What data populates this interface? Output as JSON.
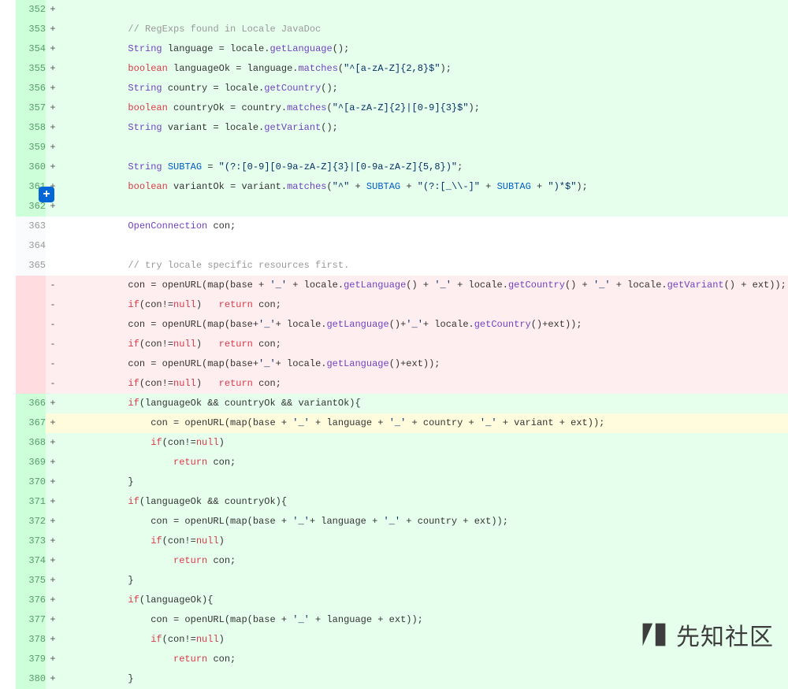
{
  "watermark": {
    "text": "先知社区"
  },
  "addCommentIcon": "+",
  "lines": [
    {
      "newNum": "352",
      "marker": "+",
      "type": "added",
      "tokens": []
    },
    {
      "newNum": "353",
      "marker": "+",
      "type": "added",
      "tokens": [
        {
          "t": "            ",
          "c": ""
        },
        {
          "t": "// RegExps found in Locale JavaDoc",
          "c": "k-cmt"
        }
      ]
    },
    {
      "newNum": "354",
      "marker": "+",
      "type": "added",
      "tokens": [
        {
          "t": "            ",
          "c": ""
        },
        {
          "t": "String",
          "c": "k-type"
        },
        {
          "t": " language = locale.",
          "c": ""
        },
        {
          "t": "getLanguage",
          "c": "k-type"
        },
        {
          "t": "();",
          "c": ""
        }
      ]
    },
    {
      "newNum": "355",
      "marker": "+",
      "type": "added",
      "tokens": [
        {
          "t": "            ",
          "c": ""
        },
        {
          "t": "boolean",
          "c": "k-kw"
        },
        {
          "t": " languageOk = language.",
          "c": ""
        },
        {
          "t": "matches",
          "c": "k-type"
        },
        {
          "t": "(",
          "c": ""
        },
        {
          "t": "\"^[a-zA-Z]{2,8}$\"",
          "c": "k-str"
        },
        {
          "t": ");",
          "c": ""
        }
      ]
    },
    {
      "newNum": "356",
      "marker": "+",
      "type": "added",
      "tokens": [
        {
          "t": "            ",
          "c": ""
        },
        {
          "t": "String",
          "c": "k-type"
        },
        {
          "t": " country = locale.",
          "c": ""
        },
        {
          "t": "getCountry",
          "c": "k-type"
        },
        {
          "t": "();",
          "c": ""
        }
      ]
    },
    {
      "newNum": "357",
      "marker": "+",
      "type": "added",
      "tokens": [
        {
          "t": "            ",
          "c": ""
        },
        {
          "t": "boolean",
          "c": "k-kw"
        },
        {
          "t": " countryOk = country.",
          "c": ""
        },
        {
          "t": "matches",
          "c": "k-type"
        },
        {
          "t": "(",
          "c": ""
        },
        {
          "t": "\"^[a-zA-Z]{2}|[0-9]{3}$\"",
          "c": "k-str"
        },
        {
          "t": ");",
          "c": ""
        }
      ]
    },
    {
      "newNum": "358",
      "marker": "+",
      "type": "added",
      "tokens": [
        {
          "t": "            ",
          "c": ""
        },
        {
          "t": "String",
          "c": "k-type"
        },
        {
          "t": " variant = locale.",
          "c": ""
        },
        {
          "t": "getVariant",
          "c": "k-type"
        },
        {
          "t": "();",
          "c": ""
        }
      ]
    },
    {
      "newNum": "359",
      "marker": "+",
      "type": "added",
      "tokens": []
    },
    {
      "newNum": "360",
      "marker": "+",
      "type": "added",
      "tokens": [
        {
          "t": "            ",
          "c": ""
        },
        {
          "t": "String",
          "c": "k-type"
        },
        {
          "t": " ",
          "c": ""
        },
        {
          "t": "SUBTAG",
          "c": "k-const"
        },
        {
          "t": " = ",
          "c": ""
        },
        {
          "t": "\"(?:[0-9][0-9a-zA-Z]{3}|[0-9a-zA-Z]{5,8})\"",
          "c": "k-str"
        },
        {
          "t": ";",
          "c": ""
        }
      ]
    },
    {
      "newNum": "361",
      "marker": "+",
      "type": "added",
      "tokens": [
        {
          "t": "            ",
          "c": ""
        },
        {
          "t": "boolean",
          "c": "k-kw"
        },
        {
          "t": " variantOk = variant.",
          "c": ""
        },
        {
          "t": "matches",
          "c": "k-type"
        },
        {
          "t": "(",
          "c": ""
        },
        {
          "t": "\"^\"",
          "c": "k-str"
        },
        {
          "t": " + ",
          "c": ""
        },
        {
          "t": "SUBTAG",
          "c": "k-const"
        },
        {
          "t": " + ",
          "c": ""
        },
        {
          "t": "\"(?:[_\\\\-]\"",
          "c": "k-str"
        },
        {
          "t": " + ",
          "c": ""
        },
        {
          "t": "SUBTAG",
          "c": "k-const"
        },
        {
          "t": " + ",
          "c": ""
        },
        {
          "t": "\")*$\"",
          "c": "k-str"
        },
        {
          "t": ");",
          "c": ""
        }
      ]
    },
    {
      "newNum": "362",
      "marker": "+",
      "type": "added",
      "tokens": []
    },
    {
      "newNum": "363",
      "marker": "",
      "type": "context",
      "tokens": [
        {
          "t": "            ",
          "c": ""
        },
        {
          "t": "OpenConnection",
          "c": "k-type"
        },
        {
          "t": " con;",
          "c": ""
        }
      ]
    },
    {
      "newNum": "364",
      "marker": "",
      "type": "context",
      "tokens": []
    },
    {
      "newNum": "365",
      "marker": "",
      "type": "context",
      "tokens": [
        {
          "t": "            ",
          "c": ""
        },
        {
          "t": "// try locale specific resources first.",
          "c": "k-cmt"
        }
      ]
    },
    {
      "newNum": "",
      "marker": "-",
      "type": "removed",
      "tokens": [
        {
          "t": "            con = openURL(map(base + ",
          "c": ""
        },
        {
          "t": "'_'",
          "c": "k-str"
        },
        {
          "t": " + locale.",
          "c": ""
        },
        {
          "t": "getLanguage",
          "c": "k-type"
        },
        {
          "t": "() + ",
          "c": ""
        },
        {
          "t": "'_'",
          "c": "k-str"
        },
        {
          "t": " + locale.",
          "c": ""
        },
        {
          "t": "getCountry",
          "c": "k-type"
        },
        {
          "t": "() + ",
          "c": ""
        },
        {
          "t": "'_'",
          "c": "k-str"
        },
        {
          "t": " + locale.",
          "c": ""
        },
        {
          "t": "getVariant",
          "c": "k-type"
        },
        {
          "t": "() + ext));",
          "c": ""
        }
      ]
    },
    {
      "newNum": "",
      "marker": "-",
      "type": "removed",
      "tokens": [
        {
          "t": "            ",
          "c": ""
        },
        {
          "t": "if",
          "c": "k-kw"
        },
        {
          "t": "(con!=",
          "c": ""
        },
        {
          "t": "null",
          "c": "k-kw"
        },
        {
          "t": ")   ",
          "c": ""
        },
        {
          "t": "return",
          "c": "k-kw"
        },
        {
          "t": " con;",
          "c": ""
        }
      ]
    },
    {
      "newNum": "",
      "marker": "-",
      "type": "removed",
      "tokens": [
        {
          "t": "            con = openURL(map(base+",
          "c": ""
        },
        {
          "t": "'_'",
          "c": "k-str"
        },
        {
          "t": "+ locale.",
          "c": ""
        },
        {
          "t": "getLanguage",
          "c": "k-type"
        },
        {
          "t": "()+",
          "c": ""
        },
        {
          "t": "'_'",
          "c": "k-str"
        },
        {
          "t": "+ locale.",
          "c": ""
        },
        {
          "t": "getCountry",
          "c": "k-type"
        },
        {
          "t": "()+ext));",
          "c": ""
        }
      ]
    },
    {
      "newNum": "",
      "marker": "-",
      "type": "removed",
      "tokens": [
        {
          "t": "            ",
          "c": ""
        },
        {
          "t": "if",
          "c": "k-kw"
        },
        {
          "t": "(con!=",
          "c": ""
        },
        {
          "t": "null",
          "c": "k-kw"
        },
        {
          "t": ")   ",
          "c": ""
        },
        {
          "t": "return",
          "c": "k-kw"
        },
        {
          "t": " con;",
          "c": ""
        }
      ]
    },
    {
      "newNum": "",
      "marker": "-",
      "type": "removed",
      "tokens": [
        {
          "t": "            con = openURL(map(base+",
          "c": ""
        },
        {
          "t": "'_'",
          "c": "k-str"
        },
        {
          "t": "+ locale.",
          "c": ""
        },
        {
          "t": "getLanguage",
          "c": "k-type"
        },
        {
          "t": "()+ext));",
          "c": ""
        }
      ]
    },
    {
      "newNum": "",
      "marker": "-",
      "type": "removed",
      "tokens": [
        {
          "t": "            ",
          "c": ""
        },
        {
          "t": "if",
          "c": "k-kw"
        },
        {
          "t": "(con!=",
          "c": ""
        },
        {
          "t": "null",
          "c": "k-kw"
        },
        {
          "t": ")   ",
          "c": ""
        },
        {
          "t": "return",
          "c": "k-kw"
        },
        {
          "t": " con;",
          "c": ""
        }
      ]
    },
    {
      "newNum": "366",
      "marker": "+",
      "type": "added",
      "tokens": [
        {
          "t": "            ",
          "c": ""
        },
        {
          "t": "if",
          "c": "k-kw"
        },
        {
          "t": "(languageOk && countryOk && variantOk){",
          "c": ""
        }
      ]
    },
    {
      "newNum": "367",
      "marker": "+",
      "type": "hl",
      "tokens": [
        {
          "t": "                con = openURL(map(base + ",
          "c": ""
        },
        {
          "t": "'_'",
          "c": "k-str"
        },
        {
          "t": " + language + ",
          "c": ""
        },
        {
          "t": "'_'",
          "c": "k-str"
        },
        {
          "t": " + country + ",
          "c": ""
        },
        {
          "t": "'_'",
          "c": "k-str"
        },
        {
          "t": " + variant + ext));",
          "c": ""
        }
      ]
    },
    {
      "newNum": "368",
      "marker": "+",
      "type": "added",
      "tokens": [
        {
          "t": "                ",
          "c": ""
        },
        {
          "t": "if",
          "c": "k-kw"
        },
        {
          "t": "(con!=",
          "c": ""
        },
        {
          "t": "null",
          "c": "k-kw"
        },
        {
          "t": ")",
          "c": ""
        }
      ]
    },
    {
      "newNum": "369",
      "marker": "+",
      "type": "added",
      "tokens": [
        {
          "t": "                    ",
          "c": ""
        },
        {
          "t": "return",
          "c": "k-kw"
        },
        {
          "t": " con;",
          "c": ""
        }
      ]
    },
    {
      "newNum": "370",
      "marker": "+",
      "type": "added",
      "tokens": [
        {
          "t": "            }",
          "c": ""
        }
      ]
    },
    {
      "newNum": "371",
      "marker": "+",
      "type": "added",
      "tokens": [
        {
          "t": "            ",
          "c": ""
        },
        {
          "t": "if",
          "c": "k-kw"
        },
        {
          "t": "(languageOk && countryOk){",
          "c": ""
        }
      ]
    },
    {
      "newNum": "372",
      "marker": "+",
      "type": "added",
      "tokens": [
        {
          "t": "                con = openURL(map(base + ",
          "c": ""
        },
        {
          "t": "'_'",
          "c": "k-str"
        },
        {
          "t": "+ language + ",
          "c": ""
        },
        {
          "t": "'_'",
          "c": "k-str"
        },
        {
          "t": " + country + ext));",
          "c": ""
        }
      ]
    },
    {
      "newNum": "373",
      "marker": "+",
      "type": "added",
      "tokens": [
        {
          "t": "                ",
          "c": ""
        },
        {
          "t": "if",
          "c": "k-kw"
        },
        {
          "t": "(con!=",
          "c": ""
        },
        {
          "t": "null",
          "c": "k-kw"
        },
        {
          "t": ")",
          "c": ""
        }
      ]
    },
    {
      "newNum": "374",
      "marker": "+",
      "type": "added",
      "tokens": [
        {
          "t": "                    ",
          "c": ""
        },
        {
          "t": "return",
          "c": "k-kw"
        },
        {
          "t": " con;",
          "c": ""
        }
      ]
    },
    {
      "newNum": "375",
      "marker": "+",
      "type": "added",
      "tokens": [
        {
          "t": "            }",
          "c": ""
        }
      ]
    },
    {
      "newNum": "376",
      "marker": "+",
      "type": "added",
      "tokens": [
        {
          "t": "            ",
          "c": ""
        },
        {
          "t": "if",
          "c": "k-kw"
        },
        {
          "t": "(languageOk){",
          "c": ""
        }
      ]
    },
    {
      "newNum": "377",
      "marker": "+",
      "type": "added",
      "tokens": [
        {
          "t": "                con = openURL(map(base + ",
          "c": ""
        },
        {
          "t": "'_'",
          "c": "k-str"
        },
        {
          "t": " + language + ext));",
          "c": ""
        }
      ]
    },
    {
      "newNum": "378",
      "marker": "+",
      "type": "added",
      "tokens": [
        {
          "t": "                ",
          "c": ""
        },
        {
          "t": "if",
          "c": "k-kw"
        },
        {
          "t": "(con!=",
          "c": ""
        },
        {
          "t": "null",
          "c": "k-kw"
        },
        {
          "t": ")",
          "c": ""
        }
      ]
    },
    {
      "newNum": "379",
      "marker": "+",
      "type": "added",
      "tokens": [
        {
          "t": "                    ",
          "c": ""
        },
        {
          "t": "return",
          "c": "k-kw"
        },
        {
          "t": " con;",
          "c": ""
        }
      ]
    },
    {
      "newNum": "380",
      "marker": "+",
      "type": "added",
      "tokens": [
        {
          "t": "            }",
          "c": ""
        }
      ]
    }
  ]
}
